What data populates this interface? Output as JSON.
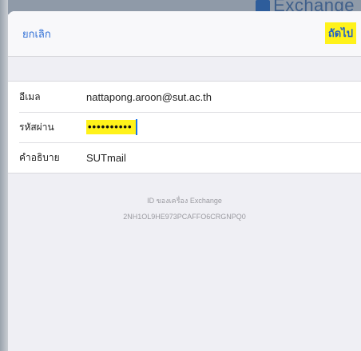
{
  "background_app": {
    "title": "Exchange"
  },
  "navbar": {
    "cancel_label": "ยกเลิก",
    "next_label": "ถัดไป"
  },
  "form": {
    "email": {
      "label": "อีเมล",
      "value": "nattapong.aroon@sut.ac.th"
    },
    "password": {
      "label": "รหัสผ่าน",
      "value": "••••••••••"
    },
    "description": {
      "label": "คำอธิบาย",
      "value": "SUTmail"
    }
  },
  "device_info": {
    "label": "ID ของเครื่อง Exchange",
    "id": "2NH1OL9HE973PCAFFO6CRGNPQ0"
  },
  "colors": {
    "accent": "#2f6fd6",
    "highlight": "#fff21a",
    "caret": "#1a73e8"
  }
}
